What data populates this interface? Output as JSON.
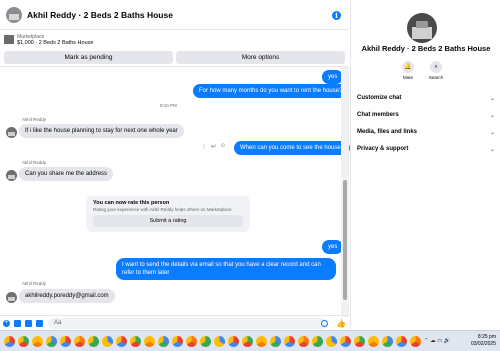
{
  "chat": {
    "header_title": "Akhil Reddy · 2 Beds 2 Baths House",
    "listing": {
      "category": "Marketplace",
      "name": "$1,000 · 2 Beds 2 Baths House"
    },
    "buttons": {
      "pending": "Mark as pending",
      "more": "More options"
    },
    "messages": {
      "m1": "yes",
      "m2": "For how many months do you want to rent the house?",
      "time": "8:10 PM",
      "sender1": "Akhil Reddy",
      "m3": "If i like the house planning to stay for next one whole year",
      "m4": "When can you come to see the house?",
      "sender2": "Akhil Reddy",
      "m5": "Can you share me the address",
      "m6": "yes",
      "m7": "I want to send the details via email so that you have a clear record and can refer to them later",
      "sender3": "Akhil Reddy",
      "m8": "akhilreddy.poreddy@gmail.com"
    },
    "rating": {
      "title": "You can now rate this person",
      "subtitle": "Rating your experience with Akhil Reddy helps others on Marketplace.",
      "button": "Submit a rating"
    },
    "composer": {
      "placeholder": "Aa"
    }
  },
  "side": {
    "name": "Akhil Reddy · 2 Beds 2 Baths House",
    "mute": "Mute",
    "search": "Search",
    "sections": [
      "Customize chat",
      "Chat members",
      "Media, files and links",
      "Privacy & support"
    ]
  },
  "taskbar": {
    "time": "8:25 pm",
    "date": "03/02/2025"
  },
  "colors": {
    "accent": "#0a7cff",
    "bubble_in": "#e4e6eb"
  }
}
